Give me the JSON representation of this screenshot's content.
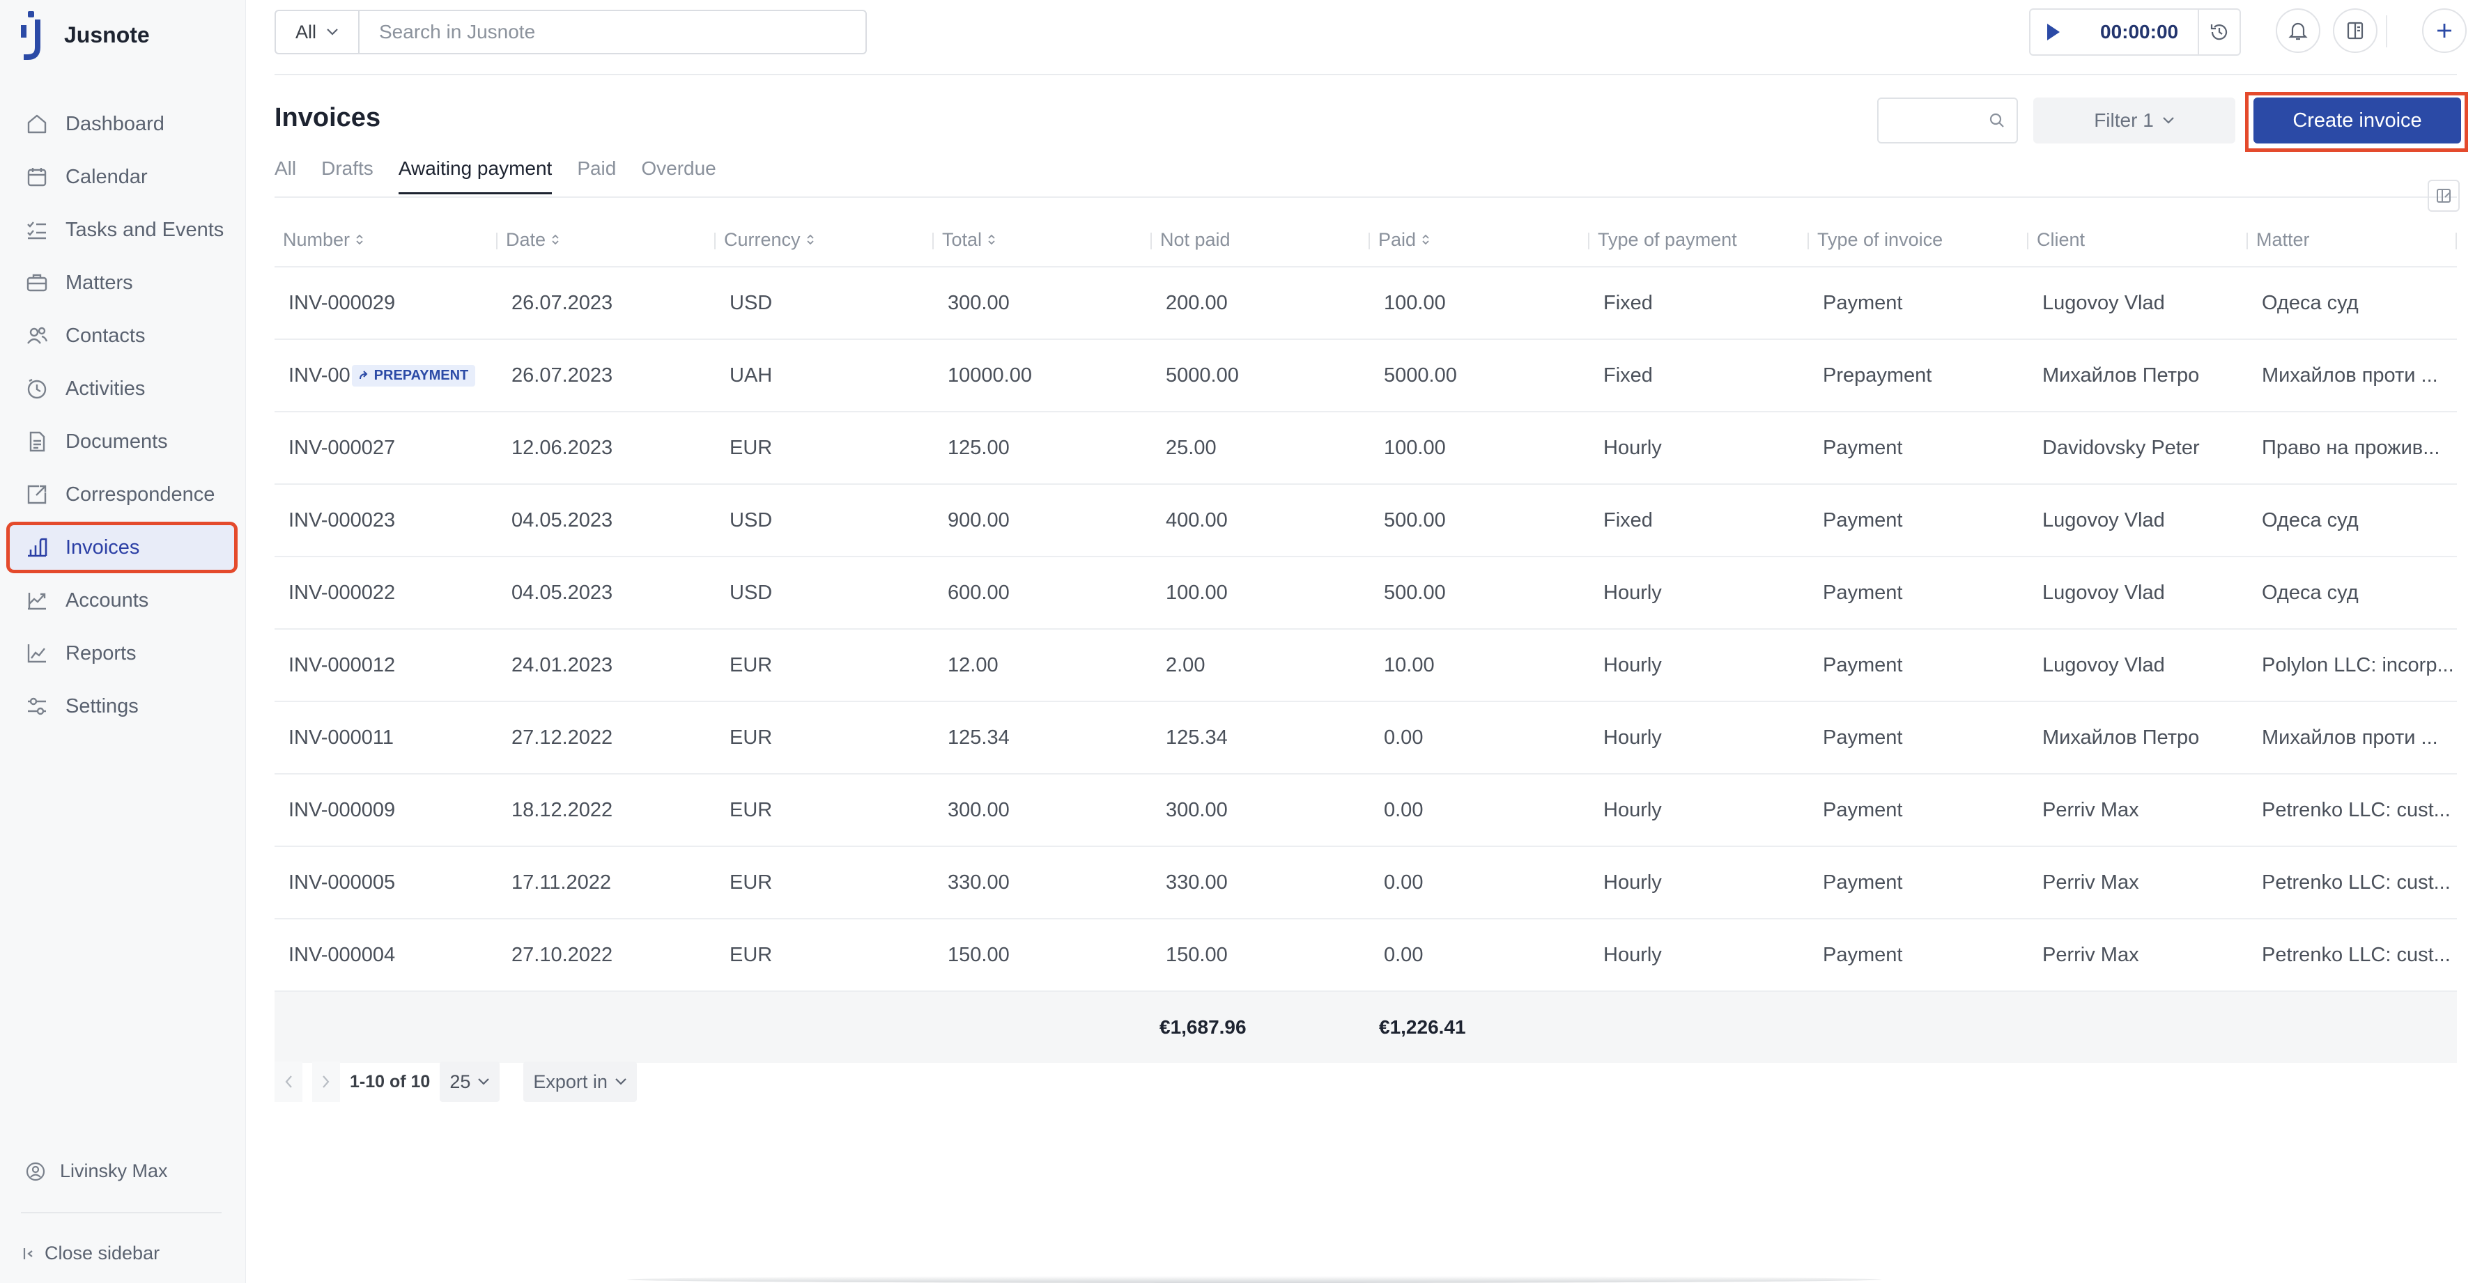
{
  "app": {
    "name": "Jusnote"
  },
  "sidebar": {
    "items": [
      {
        "label": "Dashboard",
        "icon": "home-icon"
      },
      {
        "label": "Calendar",
        "icon": "calendar-icon"
      },
      {
        "label": "Tasks and Events",
        "icon": "tasks-icon"
      },
      {
        "label": "Matters",
        "icon": "briefcase-icon"
      },
      {
        "label": "Contacts",
        "icon": "contacts-icon"
      },
      {
        "label": "Activities",
        "icon": "clock-icon"
      },
      {
        "label": "Documents",
        "icon": "document-icon"
      },
      {
        "label": "Correspondence",
        "icon": "correspondence-icon"
      },
      {
        "label": "Invoices",
        "icon": "invoice-icon",
        "active": true
      },
      {
        "label": "Accounts",
        "icon": "accounts-icon"
      },
      {
        "label": "Reports",
        "icon": "reports-icon"
      },
      {
        "label": "Settings",
        "icon": "settings-icon"
      }
    ],
    "user_name": "Livinsky Max",
    "close_label": "Close sidebar"
  },
  "topbar": {
    "search_scope": "All",
    "search_placeholder": "Search in Jusnote",
    "timer_value": "00:00:00"
  },
  "page": {
    "title": "Invoices",
    "filter_label": "Filter 1",
    "create_label": "Create invoice",
    "tabs": [
      "All",
      "Drafts",
      "Awaiting payment",
      "Paid",
      "Overdue"
    ],
    "active_tab": "Awaiting payment"
  },
  "table": {
    "columns": [
      "Number",
      "Date",
      "Currency",
      "Total",
      "Not paid",
      "Paid",
      "Type of payment",
      "Type of invoice",
      "Client",
      "Matter"
    ],
    "rows": [
      [
        "INV-000029",
        "26.07.2023",
        "USD",
        "300.00",
        "200.00",
        "100.00",
        "Fixed",
        "Payment",
        "Lugovoy Vlad",
        "Одеса суд"
      ],
      [
        "INV-00",
        "26.07.2023",
        "UAH",
        "10000.00",
        "5000.00",
        "5000.00",
        "Fixed",
        "Prepayment",
        "Михайлов Петро",
        "Михайлов проти ..."
      ],
      [
        "INV-000027",
        "12.06.2023",
        "EUR",
        "125.00",
        "25.00",
        "100.00",
        "Hourly",
        "Payment",
        "Davidovsky Peter",
        "Право на прожив..."
      ],
      [
        "INV-000023",
        "04.05.2023",
        "USD",
        "900.00",
        "400.00",
        "500.00",
        "Fixed",
        "Payment",
        "Lugovoy Vlad",
        "Одеса суд"
      ],
      [
        "INV-000022",
        "04.05.2023",
        "USD",
        "600.00",
        "100.00",
        "500.00",
        "Hourly",
        "Payment",
        "Lugovoy Vlad",
        "Одеса суд"
      ],
      [
        "INV-000012",
        "24.01.2023",
        "EUR",
        "12.00",
        "2.00",
        "10.00",
        "Hourly",
        "Payment",
        "Lugovoy Vlad",
        "Polylon LLC: incorp..."
      ],
      [
        "INV-000011",
        "27.12.2022",
        "EUR",
        "125.34",
        "125.34",
        "0.00",
        "Hourly",
        "Payment",
        "Михайлов Петро",
        "Михайлов проти ..."
      ],
      [
        "INV-000009",
        "18.12.2022",
        "EUR",
        "300.00",
        "300.00",
        "0.00",
        "Hourly",
        "Payment",
        "Perriv Max",
        "Petrenko LLC: cust..."
      ],
      [
        "INV-000005",
        "17.11.2022",
        "EUR",
        "330.00",
        "330.00",
        "0.00",
        "Hourly",
        "Payment",
        "Perriv Max",
        "Petrenko LLC: cust..."
      ],
      [
        "INV-000004",
        "27.10.2022",
        "EUR",
        "150.00",
        "150.00",
        "0.00",
        "Hourly",
        "Payment",
        "Perriv Max",
        "Petrenko LLC: cust..."
      ]
    ],
    "prepayment_badge": "PREPAYMENT",
    "total_not_paid": "€1,687.96",
    "total_paid": "€1,226.41"
  },
  "pager": {
    "range": "1-10 of 10",
    "page_size": "25",
    "export_label": "Export in"
  }
}
